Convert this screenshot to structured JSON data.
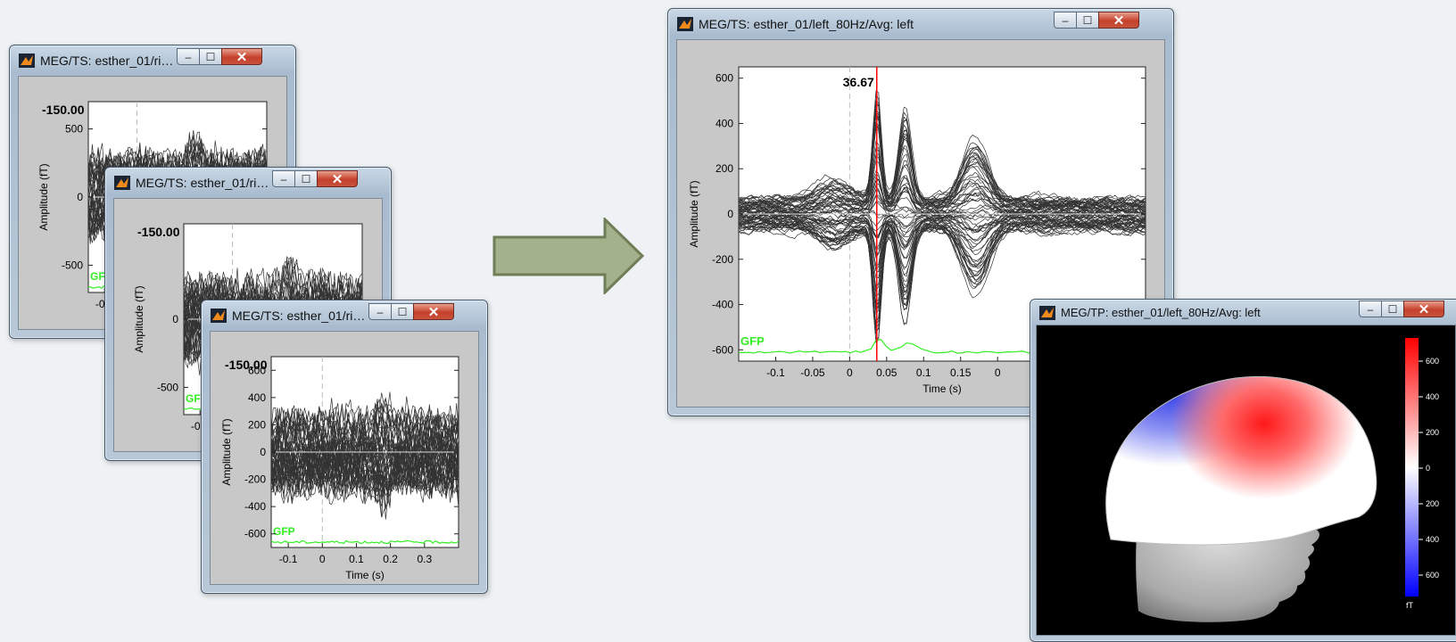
{
  "windows": {
    "left1": {
      "title": "MEG/TS: esther_01/rig...",
      "cursor_value": "-150.00",
      "ylabel": "Amplitude (fT)",
      "gfp_label": "GFP",
      "yticks": [
        "500",
        "0",
        "-500"
      ],
      "xticks": [
        "-0.1"
      ]
    },
    "left2": {
      "title": "MEG/TS: esther_01/rig...",
      "cursor_value": "-150.00",
      "ylabel": "Amplitude (fT)",
      "gfp_label": "GFP",
      "yticks": [
        "0",
        "-500"
      ],
      "xticks": [
        "-0.1"
      ]
    },
    "left3": {
      "title": "MEG/TS: esther_01/rig...",
      "cursor_value": "-150.00",
      "ylabel": "Amplitude (fT)",
      "xlabel": "Time (s)",
      "gfp_label": "GFP",
      "yticks": [
        "600",
        "400",
        "200",
        "0",
        "-200",
        "-400",
        "-600"
      ],
      "xticks": [
        "-0.1",
        "0",
        "0.1",
        "0.2",
        "0.3"
      ]
    },
    "main": {
      "title": "MEG/TS: esther_01/left_80Hz/Avg: left",
      "cursor_value": "36.67",
      "ylabel": "Amplitude (fT)",
      "xlabel": "Time (s)",
      "gfp_label": "GFP",
      "yticks": [
        "600",
        "400",
        "200",
        "0",
        "-200",
        "-400",
        "-600"
      ],
      "xticks": [
        "-0.1",
        "-0.05",
        "0",
        "0.05",
        "0.1",
        "0.15",
        "0"
      ]
    },
    "topo": {
      "title": "MEG/TP: esther_01/left_80Hz/Avg: left",
      "colorbar_ticks": [
        "600",
        "400",
        "200",
        "0",
        "200",
        "400",
        "600"
      ],
      "colorbar_unit": "fT"
    }
  },
  "controls": {
    "minimize": "–",
    "maximize": "☐",
    "close": "✕"
  },
  "colors": {
    "trace": "#333333",
    "gfp": "#33ee22",
    "cursor": "#ff0000",
    "arrow_fill": "#a4b28c",
    "arrow_stroke": "#707e58"
  },
  "chart_data": [
    {
      "type": "line",
      "title": "",
      "xlabel": "",
      "ylabel": "Amplitude (fT)",
      "xlim": [
        -0.15,
        0.4
      ],
      "ylim": [
        -700,
        700
      ],
      "cursor_x": -0.01,
      "series": [
        {
          "name": "GFP",
          "values": []
        }
      ]
    },
    {
      "type": "line",
      "title": "",
      "xlabel": "",
      "ylabel": "Amplitude (fT)",
      "xlim": [
        -0.15,
        0.4
      ],
      "ylim": [
        -700,
        700
      ],
      "cursor_x": 0.0,
      "series": [
        {
          "name": "GFP",
          "values": []
        }
      ]
    },
    {
      "type": "line",
      "title": "",
      "xlabel": "Time (s)",
      "ylabel": "Amplitude (fT)",
      "xlim": [
        -0.15,
        0.4
      ],
      "ylim": [
        -700,
        700
      ],
      "cursor_x": 0.0,
      "series": [
        {
          "name": "GFP",
          "values": []
        }
      ]
    },
    {
      "type": "line",
      "title": "",
      "xlabel": "Time (s)",
      "ylabel": "Amplitude (fT)",
      "xlim": [
        -0.15,
        0.4
      ],
      "ylim": [
        -650,
        650
      ],
      "cursor_x": 0.03667,
      "series": [
        {
          "name": "GFP",
          "values": []
        }
      ]
    }
  ]
}
